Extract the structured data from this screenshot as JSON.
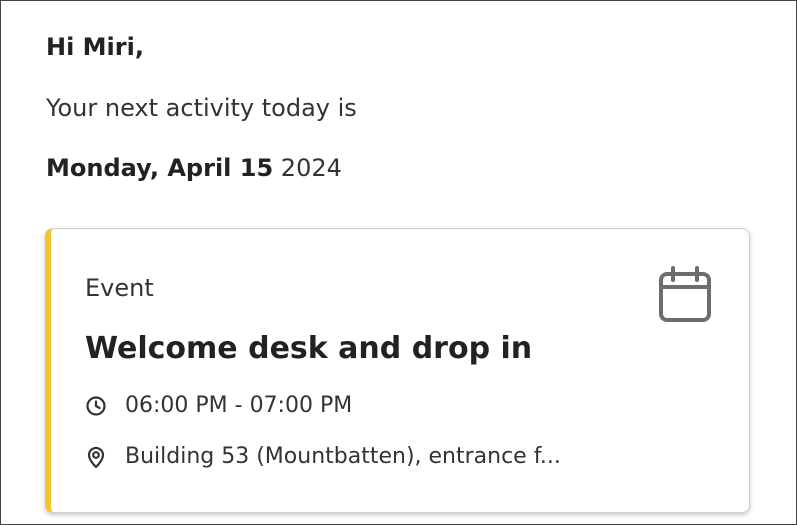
{
  "greeting": "Hi Miri,",
  "intro": "Your next activity today is",
  "date": {
    "strong": "Monday, April 15",
    "year": "2024"
  },
  "activity": {
    "type": "Event",
    "title": "Welcome desk and drop in",
    "time": "06:00 PM - 07:00 PM",
    "location": "Building 53 (Mountbatten), entrance f...",
    "accent_color": "#f2c52c",
    "icons": {
      "calendar": "calendar-icon",
      "time": "clock-icon",
      "location": "location-pin-icon"
    }
  }
}
